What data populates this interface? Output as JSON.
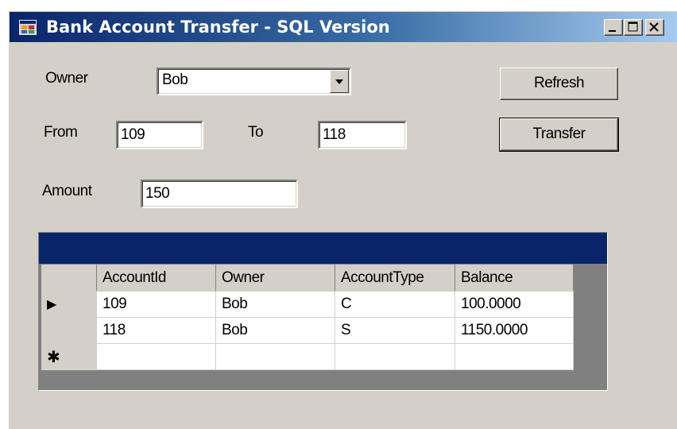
{
  "window": {
    "title": "Bank Account Transfer - SQL Version"
  },
  "form": {
    "owner_label": "Owner",
    "owner_value": "Bob",
    "from_label": "From",
    "from_value": "109",
    "to_label": "To",
    "to_value": "118",
    "amount_label": "Amount",
    "amount_value": "150",
    "refresh_label": "Refresh",
    "transfer_label": "Transfer"
  },
  "grid": {
    "columns": [
      "AccountId",
      "Owner",
      "AccountType",
      "Balance"
    ],
    "rows": [
      {
        "marker": "▶",
        "cells": [
          "109",
          "Bob",
          "C",
          "100.0000"
        ]
      },
      {
        "marker": "",
        "cells": [
          "118",
          "Bob",
          "S",
          "1150.0000"
        ]
      }
    ],
    "new_row_marker": "✱"
  },
  "colors": {
    "titlebar": "#0a246a",
    "face": "#d4d0c8",
    "grid_caption": "#0a246a"
  }
}
